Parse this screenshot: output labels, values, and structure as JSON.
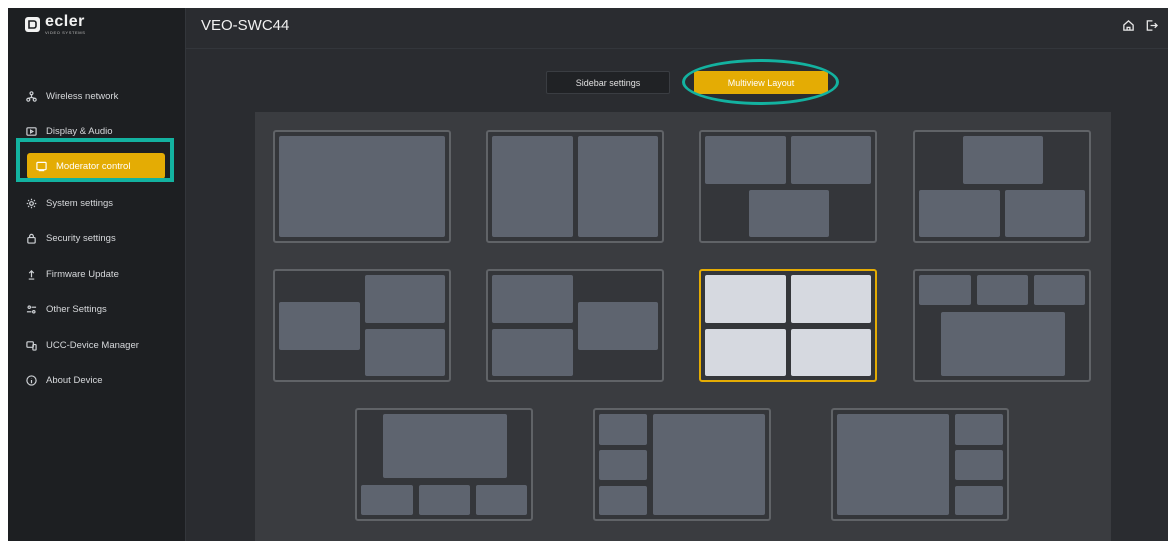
{
  "app": {
    "logo_text": "ecler",
    "logo_subtext": "VIDEO SYSTEMS",
    "device_name": "VEO-SWC44"
  },
  "header": {
    "icons": [
      "home-icon",
      "logout-icon"
    ]
  },
  "sidebar": {
    "items": [
      {
        "label": "Wireless network",
        "icon": "network-icon"
      },
      {
        "label": "Display & Audio",
        "icon": "display-icon"
      },
      {
        "label": "Moderator control",
        "icon": "monitor-icon",
        "active": true
      },
      {
        "label": "System settings",
        "icon": "gear-icon"
      },
      {
        "label": "Security settings",
        "icon": "lock-icon"
      },
      {
        "label": "Firmware Update",
        "icon": "upload-icon"
      },
      {
        "label": "Other Settings",
        "icon": "sliders-icon"
      },
      {
        "label": "UCC-Device Manager",
        "icon": "devices-icon"
      },
      {
        "label": "About Device",
        "icon": "info-icon"
      }
    ]
  },
  "tabs": {
    "sidebar_settings": "Sidebar settings",
    "multiview_layout": "Multiview Layout",
    "active": "multiview_layout"
  },
  "layouts": {
    "count": 11,
    "selected_index": 6,
    "names": [
      "single",
      "dual-side-by-side",
      "two-top-one-bottom",
      "one-top-two-bottom",
      "one-left-two-right",
      "two-left-one-right",
      "quad",
      "three-top-one-bottom",
      "one-top-three-bottom",
      "three-left-one-right",
      "one-left-three-right"
    ]
  },
  "colors": {
    "accent": "#e4ac04",
    "highlight": "#13b2a0",
    "background": "#2a2c30",
    "sidebar": "#1d1f22"
  }
}
